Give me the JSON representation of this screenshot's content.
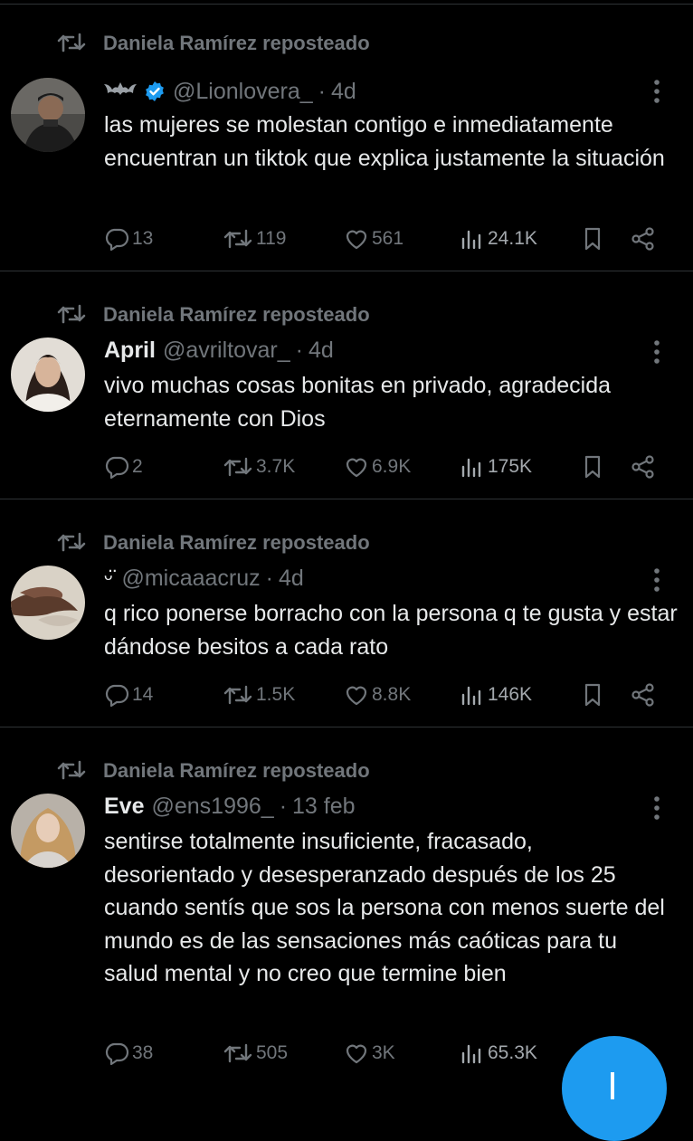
{
  "reposted_label": "Daniela Ramírez reposteado",
  "tweets": [
    {
      "name": "",
      "handle": "@Lionlovera_",
      "dot": "·",
      "time": "4d",
      "name_glyph": "bat-icon",
      "verified": true,
      "text": "las mujeres se molestan contigo e inmediatamente encuentran un tiktok que explica justamente la situación",
      "replies": "13",
      "reposts": "119",
      "likes": "561",
      "views": "24.1K"
    },
    {
      "name": "April",
      "handle": "@avriltovar_",
      "dot": "·",
      "time": "4d",
      "verified": false,
      "text": "vivo muchas cosas bonitas en privado, agradecida eternamente con Dios",
      "replies": "2",
      "reposts": "3.7K",
      "likes": "6.9K",
      "views": "175K"
    },
    {
      "name": "ᵕ̈",
      "handle": "@micaaacruz",
      "dot": "·",
      "time": "4d",
      "verified": false,
      "text": "q rico ponerse borracho con la persona q te gusta y estar dándose besitos a cada rato",
      "replies": "14",
      "reposts": "1.5K",
      "likes": "8.8K",
      "views": "146K"
    },
    {
      "name": "Eve",
      "handle": "@ens1996_",
      "dot": "·",
      "time": "13 feb",
      "verified": false,
      "text": "sentirse totalmente insuficiente, fracasado, desorientado y desesperanzado después de los 25 cuando sentís que sos la persona con menos suerte del mundo es de las sensaciones más caóticas para tu salud mental y no creo que termine bien",
      "replies": "38",
      "reposts": "505",
      "likes": "3K",
      "views": "65.3K"
    }
  ],
  "colors": {
    "background": "#000000",
    "text": "#e7e9ea",
    "muted": "#71767b",
    "divider": "#2f3336",
    "accent": "#1d9bf0"
  },
  "icons": [
    "repost-icon",
    "verified-badge-icon",
    "reply-icon",
    "retweet-icon",
    "like-icon",
    "views-icon",
    "bookmark-icon",
    "share-icon",
    "more-icon",
    "compose-icon"
  ]
}
